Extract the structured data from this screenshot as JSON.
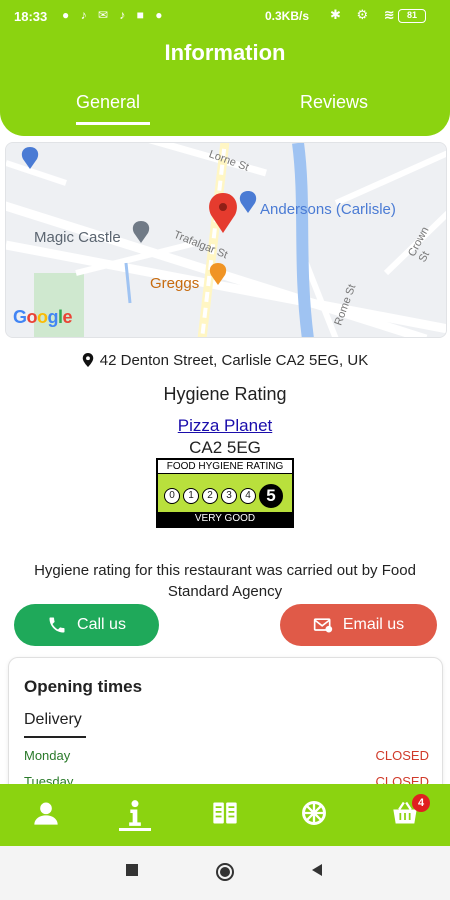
{
  "status_bar": {
    "time": "18:33",
    "speed": "0.3KB/s",
    "battery": "81"
  },
  "header": {
    "title": "Information",
    "tabs": [
      {
        "label": "General",
        "active": true
      },
      {
        "label": "Reviews",
        "active": false
      }
    ]
  },
  "map": {
    "places": {
      "andersons": "Andersons (Carlisle)",
      "magic_castle": "Magic Castle",
      "greggs": "Greggs"
    },
    "streets": {
      "lorne": "Lorne St",
      "trafalgar": "Trafalgar St",
      "crown": "Crown St",
      "rome": "Rome St"
    },
    "attribution": "Google"
  },
  "info": {
    "address": "42 Denton Street, Carlisle CA2 5EG, UK",
    "hygiene_title": "Hygiene Rating",
    "restaurant_name": "Pizza Planet",
    "postcode": "CA2 5EG",
    "fhr_badge": {
      "header": "FOOD HYGIENE RATING",
      "scale": [
        "0",
        "1",
        "2",
        "3",
        "4"
      ],
      "score": "5",
      "footer": "VERY GOOD"
    },
    "note": "Hygiene rating for this restaurant was carried out by Food Standard Agency"
  },
  "actions": {
    "call_label": "Call us",
    "email_label": "Email us"
  },
  "opening_times": {
    "title": "Opening times",
    "tab": "Delivery",
    "rows": [
      {
        "day": "Monday",
        "status": "CLOSED"
      },
      {
        "day": "Tuesday",
        "status": "CLOSED"
      }
    ]
  },
  "bottom_nav": {
    "items": [
      "profile-icon",
      "info-icon",
      "menu-book-icon",
      "wheel-icon",
      "basket-icon"
    ],
    "basket_badge": "4"
  },
  "colors": {
    "brand_green": "#8bd310",
    "call_green": "#1fa95a",
    "email_red": "#e05a48"
  }
}
